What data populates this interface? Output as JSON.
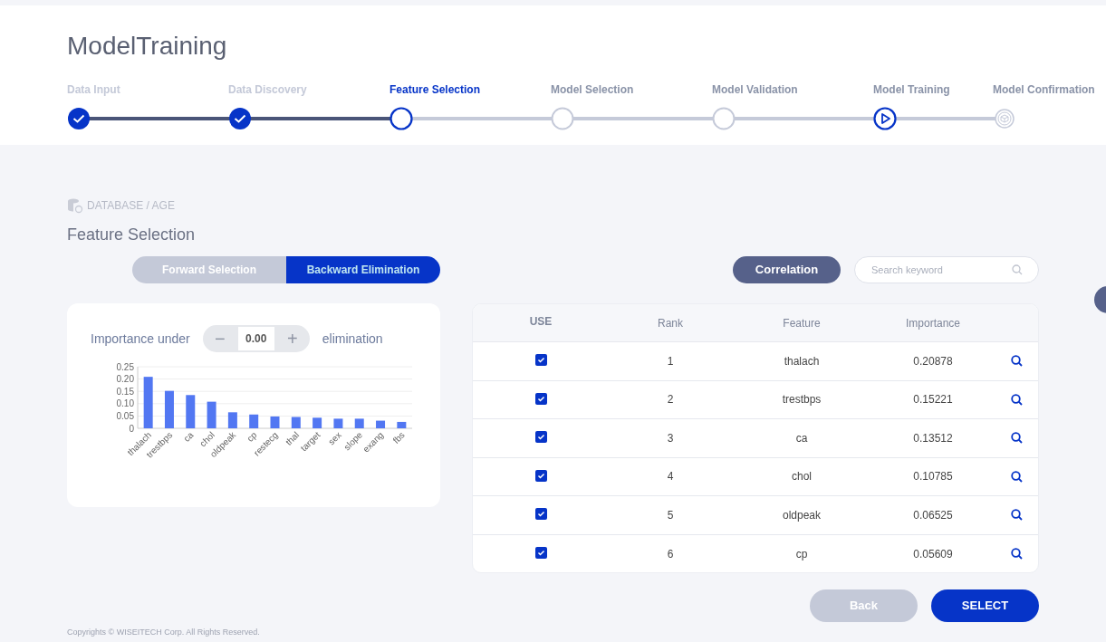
{
  "title": "ModelTraining",
  "steps": [
    {
      "label": "Data Input",
      "kind": "done"
    },
    {
      "label": "Data Discovery",
      "kind": "done"
    },
    {
      "label": "Feature Selection",
      "kind": "current"
    },
    {
      "label": "Model Selection",
      "kind": "pending"
    },
    {
      "label": "Model Validation",
      "kind": "pending"
    },
    {
      "label": "Model Training",
      "kind": "training"
    },
    {
      "label": "Model Confirmation",
      "kind": "final"
    }
  ],
  "breadcrumb": "DATABASE / AGE",
  "section_title": "Feature Selection",
  "modes": [
    {
      "label": "Forward Selection",
      "selected": false
    },
    {
      "label": "Backward Elimination",
      "selected": true
    }
  ],
  "correlation_button": "Correlation",
  "search": {
    "placeholder": "Search keyword"
  },
  "importance": {
    "label_before": "Importance under",
    "minus": "−",
    "value": "0.00",
    "plus": "+",
    "label_after": "elimination",
    "chart_data": {
      "type": "bar",
      "categories": [
        "thalach",
        "trestbps",
        "ca",
        "chol",
        "oldpeak",
        "cp",
        "restecg",
        "thal",
        "target",
        "sex",
        "slope",
        "exang",
        "fbs"
      ],
      "values": [
        0.209,
        0.152,
        0.135,
        0.108,
        0.065,
        0.056,
        0.048,
        0.046,
        0.043,
        0.039,
        0.039,
        0.031,
        0.026
      ],
      "ylim": [
        0,
        0.25
      ],
      "grid": true,
      "yticks": [
        {
          "value": 0,
          "label": "0"
        },
        {
          "value": 0.05,
          "label": "0.05"
        },
        {
          "value": 0.1,
          "label": "0.10"
        },
        {
          "value": 0.15,
          "label": "0.15"
        },
        {
          "value": 0.2,
          "label": "0.20"
        },
        {
          "value": 0.25,
          "label": "0.25"
        }
      ]
    }
  },
  "table": {
    "columns": [
      "USE",
      "Rank",
      "Feature",
      "Importance"
    ],
    "rows": [
      {
        "use": true,
        "rank": "1",
        "feature": "thalach",
        "importance": "0.20878"
      },
      {
        "use": true,
        "rank": "2",
        "feature": "trestbps",
        "importance": "0.15221"
      },
      {
        "use": true,
        "rank": "3",
        "feature": "ca",
        "importance": "0.13512"
      },
      {
        "use": true,
        "rank": "4",
        "feature": "chol",
        "importance": "0.10785"
      },
      {
        "use": true,
        "rank": "5",
        "feature": "oldpeak",
        "importance": "0.06525"
      },
      {
        "use": true,
        "rank": "6",
        "feature": "cp",
        "importance": "0.05609"
      }
    ]
  },
  "buttons": {
    "back": "Back",
    "select": "SELECT"
  },
  "footer": "Copyrights © WISEITECH Corp. All Rights Reserved."
}
